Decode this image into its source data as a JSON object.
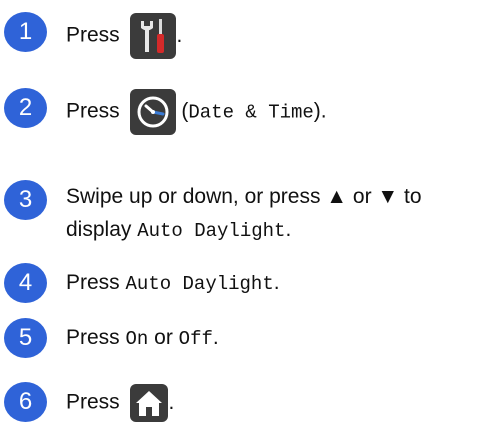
{
  "steps": [
    {
      "number": "1",
      "press": "Press",
      "icon": "settings-tools-icon",
      "end": "."
    },
    {
      "number": "2",
      "press": "Press",
      "icon": "clock-icon",
      "paren_open": "(",
      "label": "Date & Time",
      "paren_close": ").",
      "end": ""
    },
    {
      "number": "3",
      "line1": "Swipe up or down, or press ▲ or ▼ to",
      "line2_prefix": "display ",
      "line2_mono": "Auto Daylight",
      "line2_end": "."
    },
    {
      "number": "4",
      "press": "Press ",
      "mono": "Auto Daylight",
      "end": "."
    },
    {
      "number": "5",
      "press": "Press ",
      "on": "On",
      "or": " or ",
      "off": "Off",
      "end": "."
    },
    {
      "number": "6",
      "press": "Press",
      "icon": "home-icon",
      "end": "."
    }
  ],
  "colors": {
    "step_circle": "#2f63d8",
    "icon_bg": "#3b3b3b"
  }
}
